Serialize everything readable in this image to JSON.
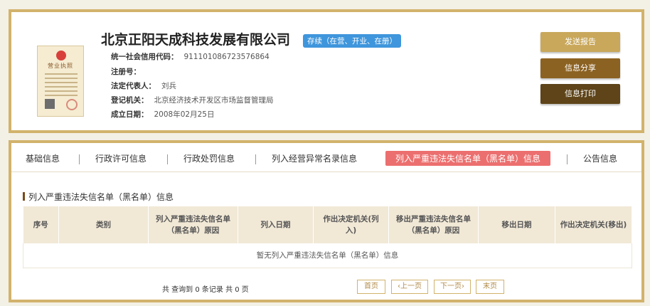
{
  "company": {
    "name": "北京正阳天成科技发展有限公司",
    "status": "存续（在营、开业、在册）",
    "license_title": "营业执照"
  },
  "info": [
    {
      "key": "统一社会信用代码：",
      "value": "911101086723576864"
    },
    {
      "key": "注册号：",
      "value": ""
    },
    {
      "key": "法定代表人：",
      "value": "刘兵"
    },
    {
      "key": "登记机关：",
      "value": "北京经济技术开发区市场监督管理局"
    },
    {
      "key": "成立日期：",
      "value": "2008年02月25日"
    }
  ],
  "buttons": {
    "send_report": "发送报告",
    "share": "信息分享",
    "print": "信息打印"
  },
  "tabs": [
    "基础信息",
    "行政许可信息",
    "行政处罚信息",
    "列入经营异常名录信息",
    "列入严重违法失信名单（黑名单）信息",
    "公告信息"
  ],
  "section": {
    "title": "列入严重违法失信名单（黑名单）信息",
    "columns": [
      "序号",
      "类别",
      "列入严重违法失信名单（黑名单）原因",
      "列入日期",
      "作出决定机关(列入)",
      "移出严重违法失信名单（黑名单）原因",
      "移出日期",
      "作出决定机关(移出)"
    ],
    "empty_text": "暂无列入严重违法失信名单（黑名单）信息"
  },
  "pager": {
    "summary": "共 查询到 0 条记录 共 0 页",
    "first": "首页",
    "prev": "‹上一页",
    "next": "下一页›",
    "last": "末页"
  },
  "colors": {
    "border": "#d2b36c",
    "btn_send": "#c9a85b",
    "btn_share": "#8c6222",
    "btn_print": "#5e4418",
    "tab_active": "#ec6f6f",
    "status_badge": "#3f96dc"
  }
}
